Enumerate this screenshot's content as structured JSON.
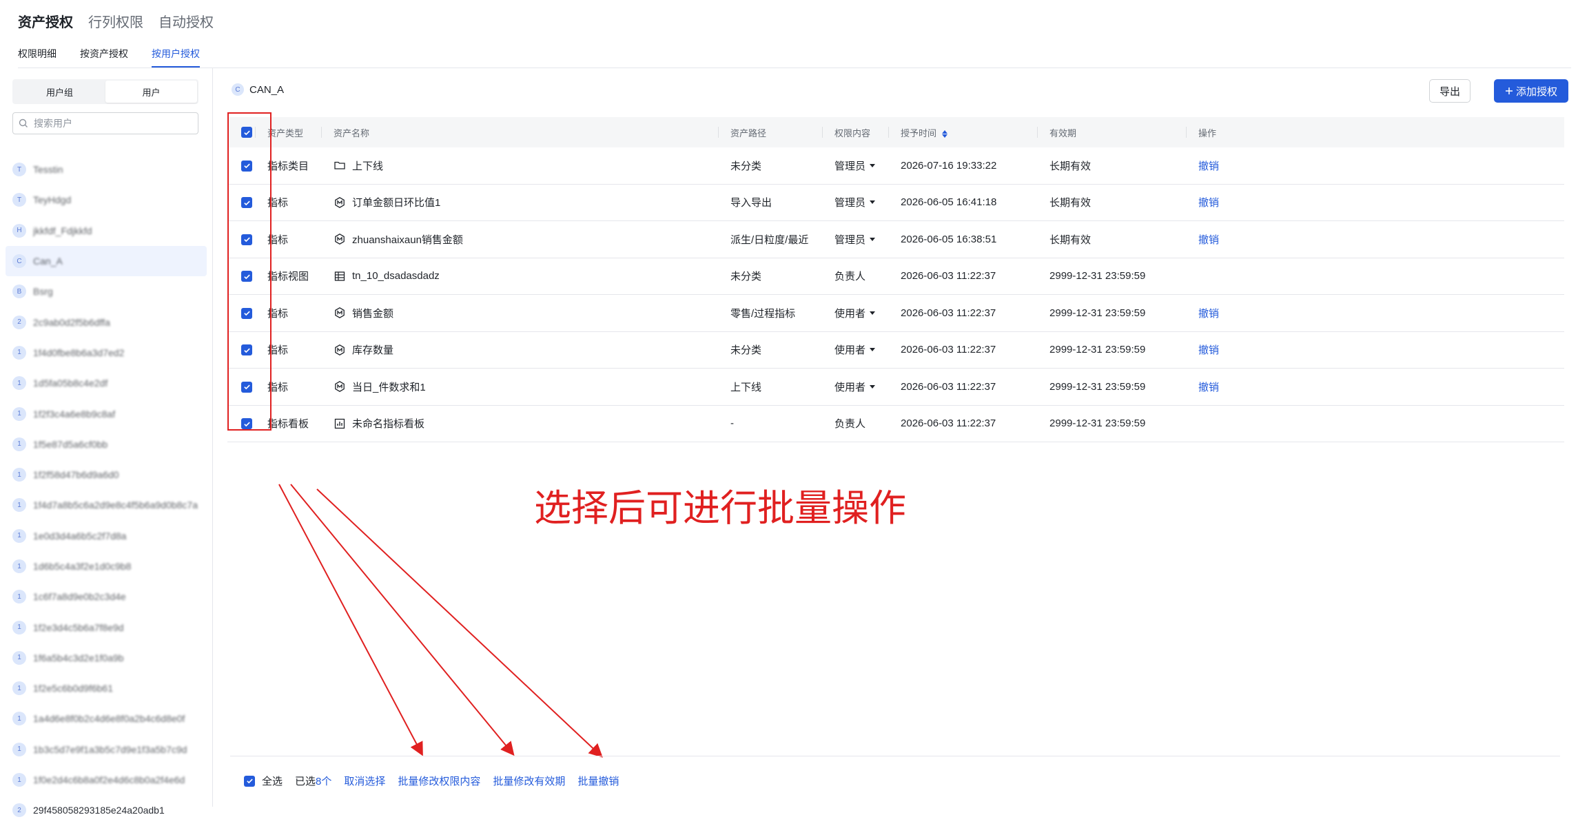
{
  "top_tabs": [
    "资产授权",
    "行列权限",
    "自动授权"
  ],
  "sub_tabs": [
    "权限明细",
    "按资产授权",
    "按用户授权"
  ],
  "sidebar": {
    "segments": [
      "用户组",
      "用户"
    ],
    "search_placeholder": "搜索用户",
    "users": [
      {
        "avatar": "T",
        "name": "Tesstin"
      },
      {
        "avatar": "T",
        "name": "TeyHdgd"
      },
      {
        "avatar": "H",
        "name": "jkkfdf_Fdjkkfd"
      },
      {
        "avatar": "C",
        "name": "Can_A"
      },
      {
        "avatar": "B",
        "name": "Bsrg"
      },
      {
        "avatar": "2",
        "name": "2c9ab0d2f5b6dffa"
      },
      {
        "avatar": "1",
        "name": "1f4d0fbe8b6a3d7ed2"
      },
      {
        "avatar": "1",
        "name": "1d5fa05b8c4e2df"
      },
      {
        "avatar": "1",
        "name": "1f2f3c4a6e8b9c8af"
      },
      {
        "avatar": "1",
        "name": "1f5e87d5a6cf0bb"
      },
      {
        "avatar": "1",
        "name": "1f2f58d47b6d9a6d0"
      },
      {
        "avatar": "1",
        "name": "1f4d7a8b5c6a2d9e8c4f5b6a9d0b8c7a"
      },
      {
        "avatar": "1",
        "name": "1e0d3d4a6b5c2f7d8a"
      },
      {
        "avatar": "1",
        "name": "1d6b5c4a3f2e1d0c9b8"
      },
      {
        "avatar": "1",
        "name": "1c6f7a8d9e0b2c3d4e"
      },
      {
        "avatar": "1",
        "name": "1f2e3d4c5b6a7f8e9d"
      },
      {
        "avatar": "1",
        "name": "1f6a5b4c3d2e1f0a9b"
      },
      {
        "avatar": "1",
        "name": "1f2e5c6b0d9f6b61"
      },
      {
        "avatar": "1",
        "name": "1a4d6e8f0b2c4d6e8f0a2b4c6d8e0f"
      },
      {
        "avatar": "1",
        "name": "1b3c5d7e9f1a3b5c7d9e1f3a5b7c9d"
      },
      {
        "avatar": "1",
        "name": "1f0e2d4c6b8a0f2e4d6c8b0a2f4e6d"
      },
      {
        "avatar": "2",
        "name": "29f458058293185e24a20adb1"
      }
    ]
  },
  "main": {
    "breadcrumb_avatar": "C",
    "breadcrumb": "CAN_A",
    "export_label": "导出",
    "add_label": "添加授权",
    "add_icon": "plus-icon",
    "columns": [
      "资产类型",
      "资产名称",
      "资产路径",
      "权限内容",
      "授予时间",
      "有效期",
      "操作"
    ],
    "rows": [
      {
        "type": "指标类目",
        "icon": "folder",
        "name": "上下线",
        "path": "未分类",
        "perm": "管理员",
        "perm_dropdown": true,
        "time": "2026-07-16 19:33:22",
        "expire": "长期有效",
        "action": "撤销"
      },
      {
        "type": "指标",
        "icon": "metric",
        "name": "订单金额日环比值1",
        "path": "导入导出",
        "perm": "管理员",
        "perm_dropdown": true,
        "time": "2026-06-05 16:41:18",
        "expire": "长期有效",
        "action": "撤销"
      },
      {
        "type": "指标",
        "icon": "metric",
        "name": "zhuanshaixaun销售金额",
        "path": "派生/日粒度/最近",
        "perm": "管理员",
        "perm_dropdown": true,
        "time": "2026-06-05 16:38:51",
        "expire": "长期有效",
        "action": "撤销"
      },
      {
        "type": "指标视图",
        "icon": "table",
        "name": "tn_10_dsadasdadz",
        "path": "未分类",
        "perm": "负责人",
        "perm_dropdown": false,
        "time": "2026-06-03 11:22:37",
        "expire": "2999-12-31 23:59:59",
        "action": ""
      },
      {
        "type": "指标",
        "icon": "metric",
        "name": "销售金额",
        "path": "零售/过程指标",
        "perm": "使用者",
        "perm_dropdown": true,
        "time": "2026-06-03 11:22:37",
        "expire": "2999-12-31 23:59:59",
        "action": "撤销"
      },
      {
        "type": "指标",
        "icon": "metric",
        "name": "库存数量",
        "path": "未分类",
        "perm": "使用者",
        "perm_dropdown": true,
        "time": "2026-06-03 11:22:37",
        "expire": "2999-12-31 23:59:59",
        "action": "撤销"
      },
      {
        "type": "指标",
        "icon": "metric",
        "name": "当日_件数求和1",
        "path": "上下线",
        "perm": "使用者",
        "perm_dropdown": true,
        "time": "2026-06-03 11:22:37",
        "expire": "2999-12-31 23:59:59",
        "action": "撤销"
      },
      {
        "type": "指标看板",
        "icon": "dashboard",
        "name": "未命名指标看板",
        "path": "-",
        "perm": "负责人",
        "perm_dropdown": false,
        "time": "2026-06-03 11:22:37",
        "expire": "2999-12-31 23:59:59",
        "action": ""
      }
    ]
  },
  "annotation": "选择后可进行批量操作",
  "bottom_bar": {
    "select_all": "全选",
    "selected_prefix": "已选",
    "selected_count": "8个",
    "cancel": "取消选择",
    "batch_edit_perm": "批量修改权限内容",
    "batch_edit_expire": "批量修改有效期",
    "batch_revoke": "批量撤销"
  },
  "colors": {
    "accent": "#245bdb",
    "annotation": "#e02020"
  }
}
